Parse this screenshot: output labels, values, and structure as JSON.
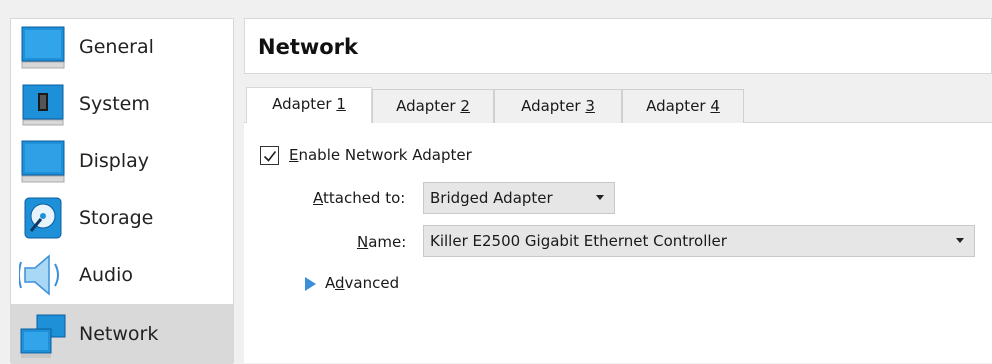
{
  "sidebar": {
    "items": [
      {
        "label": "General",
        "icon": "general-icon",
        "selected": false
      },
      {
        "label": "System",
        "icon": "system-icon",
        "selected": false
      },
      {
        "label": "Display",
        "icon": "display-icon",
        "selected": false
      },
      {
        "label": "Storage",
        "icon": "storage-icon",
        "selected": false
      },
      {
        "label": "Audio",
        "icon": "audio-icon",
        "selected": false
      },
      {
        "label": "Network",
        "icon": "network-icon",
        "selected": true
      }
    ]
  },
  "header": {
    "title": "Network"
  },
  "tabs": [
    {
      "prefix": "Adapter ",
      "key": "1",
      "active": true
    },
    {
      "prefix": "Adapter ",
      "key": "2",
      "active": false
    },
    {
      "prefix": "Adapter ",
      "key": "3",
      "active": false
    },
    {
      "prefix": "Adapter ",
      "key": "4",
      "active": false
    }
  ],
  "adapter": {
    "enable": {
      "key": "E",
      "rest": "nable Network Adapter",
      "checked": true
    },
    "attached_to": {
      "key": "A",
      "rest": "ttached to:",
      "value": "Bridged Adapter"
    },
    "name": {
      "key": "N",
      "rest": "ame:",
      "value": "Killer E2500 Gigabit Ethernet Controller"
    },
    "advanced": {
      "pre": "A",
      "key": "d",
      "rest": "vanced",
      "expanded": false
    }
  },
  "colors": {
    "accent_blue": "#1e90d8",
    "selection_gray": "#d9d9d9"
  }
}
